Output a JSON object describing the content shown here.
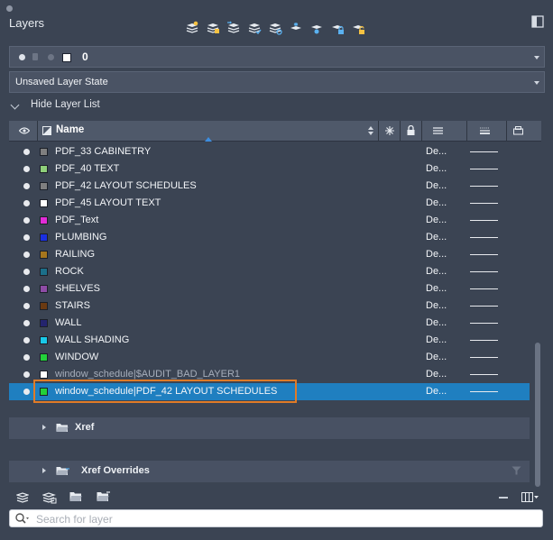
{
  "window": {
    "title": "Layers"
  },
  "toolbar": {
    "buttons": [
      {
        "icon": "new-layer-icon"
      },
      {
        "icon": "new-vp-frozen-layer-icon"
      },
      {
        "icon": "move-layer-icon"
      },
      {
        "icon": "set-current-layer-icon"
      },
      {
        "icon": "layer-properties-icon"
      },
      {
        "icon": "freeze-layer-icon"
      },
      {
        "icon": "isolate-layer-icon"
      },
      {
        "icon": "lock-layer-icon"
      },
      {
        "icon": "unlock-layer-icon"
      }
    ]
  },
  "current_layer": {
    "name": "0",
    "color": "#ffffff"
  },
  "layer_state": {
    "label": "Unsaved Layer State"
  },
  "hide_list": {
    "label": "Hide Layer List"
  },
  "columns": {
    "name": "Name"
  },
  "layers": [
    {
      "name": "PDF_33 CABINETRY",
      "color": "#7f7f7f",
      "linetype": "De...",
      "dim": false,
      "selected": false
    },
    {
      "name": "PDF_40 TEXT",
      "color": "#8fd07a",
      "linetype": "De...",
      "dim": false,
      "selected": false
    },
    {
      "name": "PDF_42 LAYOUT SCHEDULES",
      "color": "#7f7f7f",
      "linetype": "De...",
      "dim": false,
      "selected": false
    },
    {
      "name": "PDF_45 LAYOUT TEXT",
      "color": "#ffffff",
      "linetype": "De...",
      "dim": false,
      "selected": false
    },
    {
      "name": "PDF_Text",
      "color": "#e22cd8",
      "linetype": "De...",
      "dim": false,
      "selected": false
    },
    {
      "name": "PLUMBING",
      "color": "#1a2fe0",
      "linetype": "De...",
      "dim": false,
      "selected": false
    },
    {
      "name": "RAILING",
      "color": "#a6761d",
      "linetype": "De...",
      "dim": false,
      "selected": false
    },
    {
      "name": "ROCK",
      "color": "#1b6f8a",
      "linetype": "De...",
      "dim": false,
      "selected": false
    },
    {
      "name": "SHELVES",
      "color": "#8e4ca6",
      "linetype": "De...",
      "dim": false,
      "selected": false
    },
    {
      "name": "STAIRS",
      "color": "#6b3a12",
      "linetype": "De...",
      "dim": false,
      "selected": false
    },
    {
      "name": "WALL",
      "color": "#24246e",
      "linetype": "De...",
      "dim": false,
      "selected": false
    },
    {
      "name": "WALL SHADING",
      "color": "#19c8e8",
      "linetype": "De...",
      "dim": false,
      "selected": false
    },
    {
      "name": "WINDOW",
      "color": "#23d13a",
      "linetype": "De...",
      "dim": false,
      "selected": false
    },
    {
      "name": "window_schedule|$AUDIT_BAD_LAYER1",
      "color": "#ffffff",
      "linetype": "De...",
      "dim": true,
      "selected": false
    },
    {
      "name": "window_schedule|PDF_42 LAYOUT SCHEDULES",
      "color": "#23d13a",
      "linetype": "De...",
      "dim": false,
      "selected": true
    }
  ],
  "groups": [
    {
      "label": "Xref"
    },
    {
      "label": "Xref Overrides"
    }
  ],
  "search": {
    "placeholder": "Search for layer",
    "value": ""
  }
}
